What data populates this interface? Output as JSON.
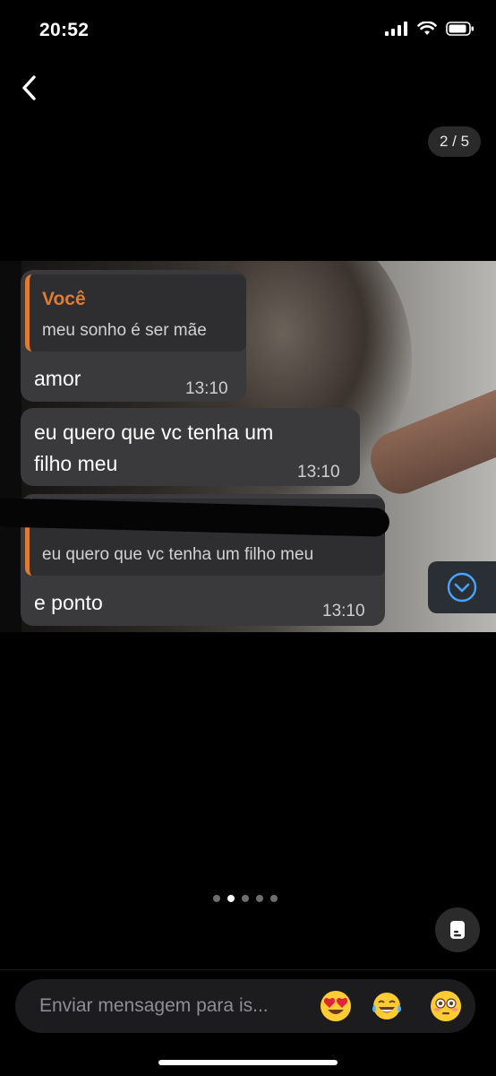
{
  "status_bar": {
    "time": "20:52"
  },
  "viewer": {
    "counter": "2 / 5",
    "current_page": 2,
    "total_pages": 5
  },
  "messages": [
    {
      "quote_name": "Você",
      "quote_text": "meu sonho é ser mãe",
      "text": "amor",
      "time": "13:10"
    },
    {
      "text_line1": "eu quero que vc tenha um",
      "text_line2": "filho meu",
      "time": "13:10"
    },
    {
      "quote_text": "eu quero que vc tenha um filho meu",
      "text": "e ponto",
      "time": "13:10"
    }
  ],
  "composer": {
    "placeholder": "Enviar mensagem para is...",
    "quick_reactions": [
      "heart-eyes-emoji",
      "tears-of-joy-emoji",
      "flushed-emoji"
    ]
  },
  "colors": {
    "accent_orange": "#e07b32",
    "bubble": "#3a3a3c",
    "scroll_button_icon": "#4aa3ff"
  }
}
